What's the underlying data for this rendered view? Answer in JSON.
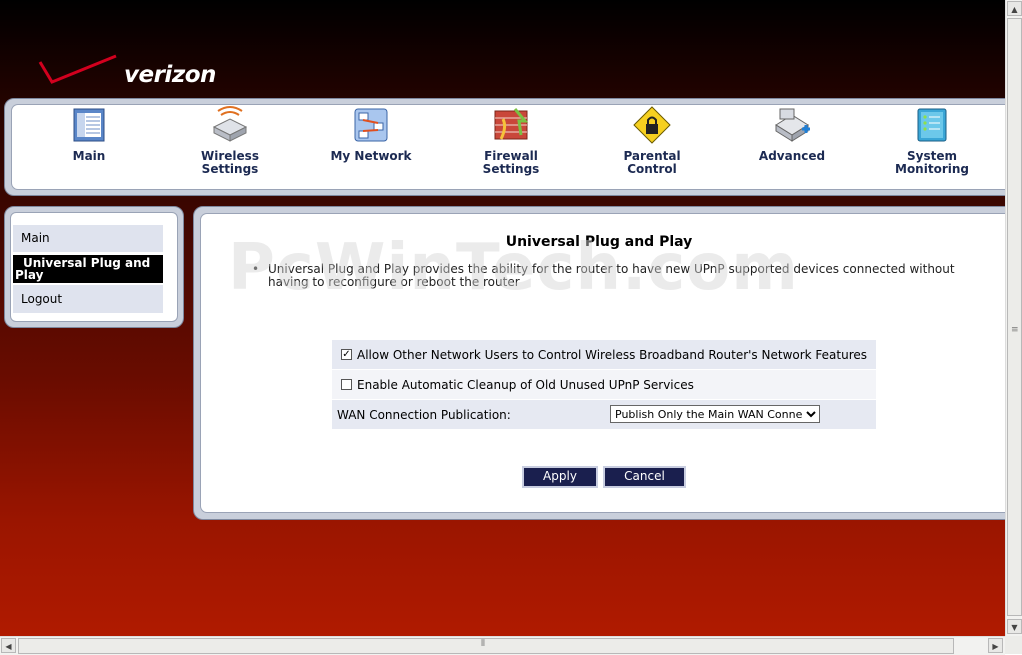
{
  "brand": {
    "logo_text": "verizon",
    "accent": "#d2001e"
  },
  "topnav": {
    "items": [
      {
        "label": "Main",
        "icon": "main-icon"
      },
      {
        "label": "Wireless Settings",
        "icon": "wireless-settings-icon"
      },
      {
        "label": "My Network",
        "icon": "my-network-icon"
      },
      {
        "label": "Firewall Settings",
        "icon": "firewall-settings-icon"
      },
      {
        "label": "Parental Control",
        "icon": "parental-control-icon"
      },
      {
        "label": "Advanced",
        "icon": "advanced-icon"
      },
      {
        "label": "System Monitoring",
        "icon": "system-monitoring-icon"
      }
    ]
  },
  "sidebar": {
    "items": [
      {
        "label": "Main"
      },
      {
        "label": "Universal Plug and Play",
        "active": true
      },
      {
        "label": "Logout"
      }
    ]
  },
  "page": {
    "title": "Universal Plug and Play",
    "watermark": "PcWinTech.com",
    "description": "Universal Plug and Play provides the ability for the router to have new UPnP supported devices connected without having to reconfigure or reboot the router",
    "allow_control": {
      "label": "Allow Other Network Users to Control Wireless Broadband Router's Network Features",
      "checked": true
    },
    "auto_cleanup": {
      "label": "Enable Automatic Cleanup of Old Unused UPnP Services",
      "checked": false
    },
    "wan_publication": {
      "label": "WAN Connection Publication:",
      "selected": "Publish Only the Main WAN Connection"
    },
    "apply_label": "Apply",
    "cancel_label": "Cancel"
  }
}
